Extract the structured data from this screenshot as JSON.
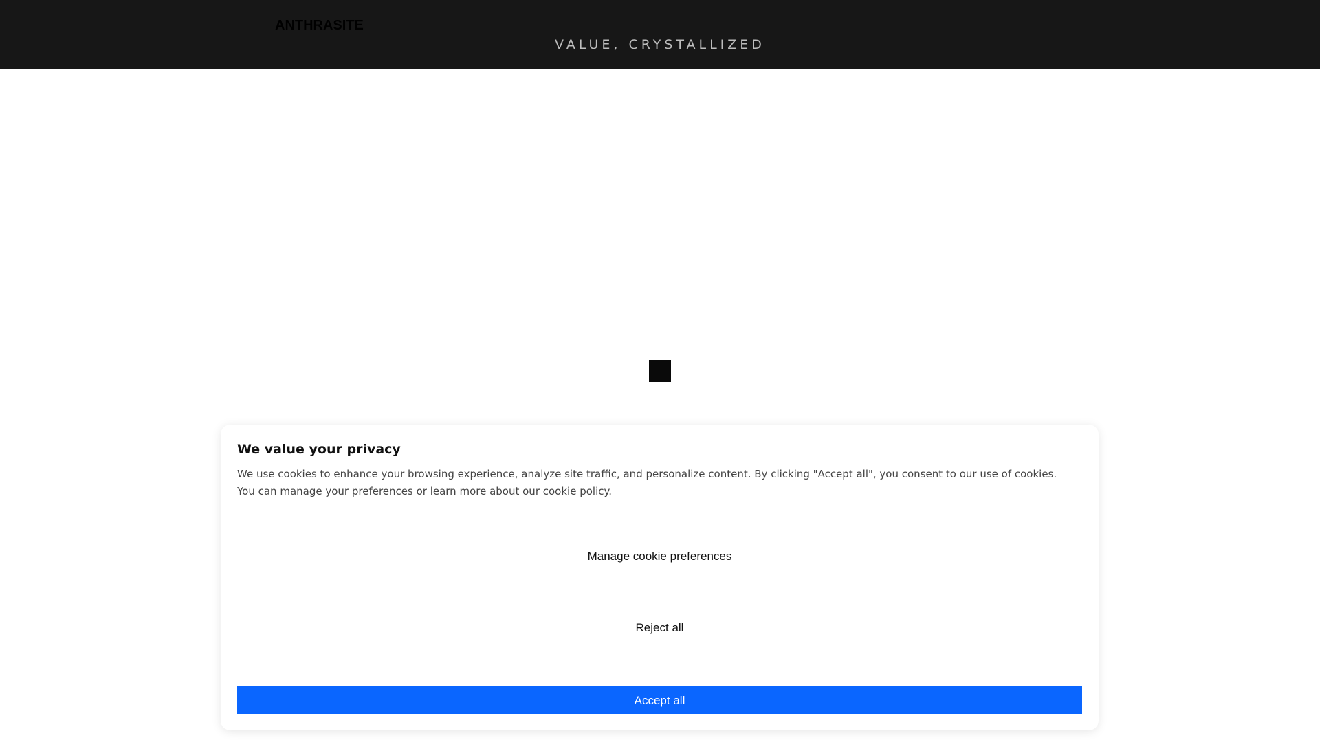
{
  "header": {
    "brand": "ANTHRASITE",
    "tagline": "VALUE, CRYSTALLIZED"
  },
  "colors": {
    "header_bg": "#171717",
    "accent": "#0a66ff",
    "loader": "#0a0a0a"
  },
  "cookie_banner": {
    "title": "We value your privacy",
    "text": "We use cookies to enhance your browsing experience, analyze site traffic, and personalize content. By clicking \"Accept all\", you consent to our use of cookies. You can manage your preferences or learn more about our cookie policy.",
    "manage_label": "Manage cookie preferences",
    "reject_label": "Reject all",
    "accept_label": "Accept all"
  }
}
